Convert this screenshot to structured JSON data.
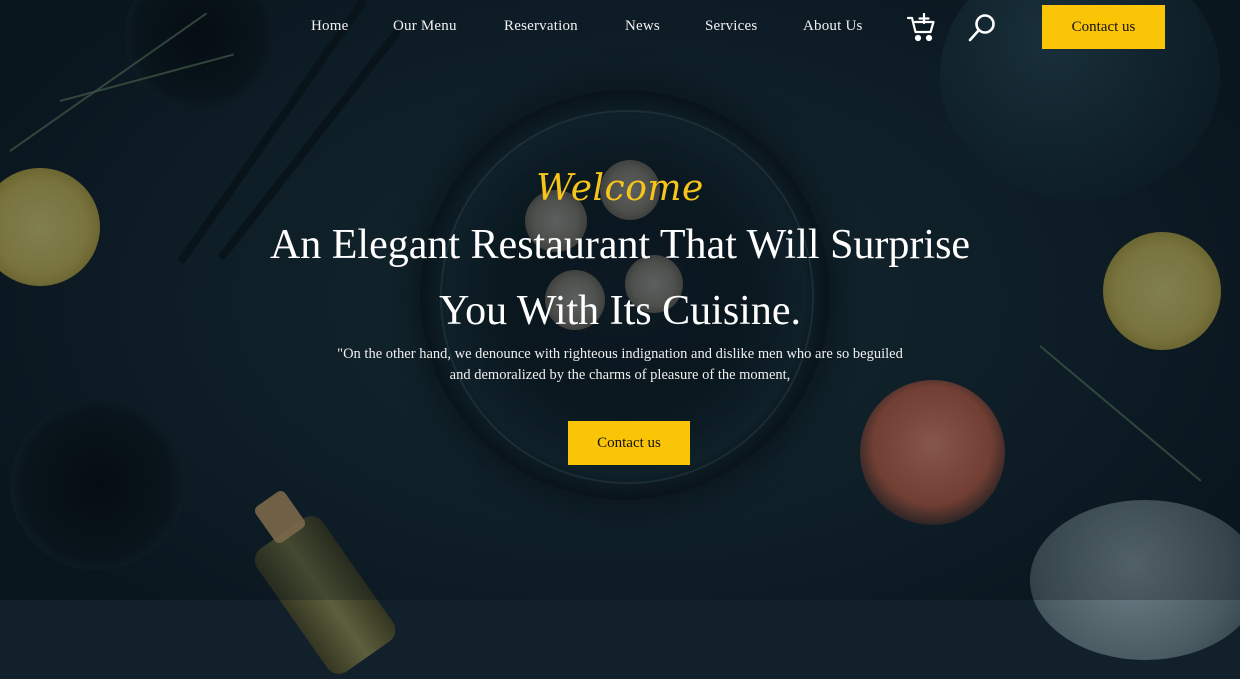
{
  "nav": {
    "links": [
      "Home",
      "Our Menu",
      "Reservation",
      "News",
      "Services",
      "About Us"
    ],
    "contact_label": "Contact us",
    "icons": [
      "cart-icon",
      "search-icon"
    ]
  },
  "hero": {
    "welcome": "Welcome",
    "headline": "An Elegant Restaurant That Will Surprise You With Its Cuisine.",
    "lead": "\"On the other hand, we denounce with righteous indignation and dislike men who are so beguiled and demoralized by the charms of pleasure of the moment,",
    "cta_label": "Contact us"
  },
  "colors": {
    "accent": "#fbc507",
    "background": "#12202b"
  }
}
